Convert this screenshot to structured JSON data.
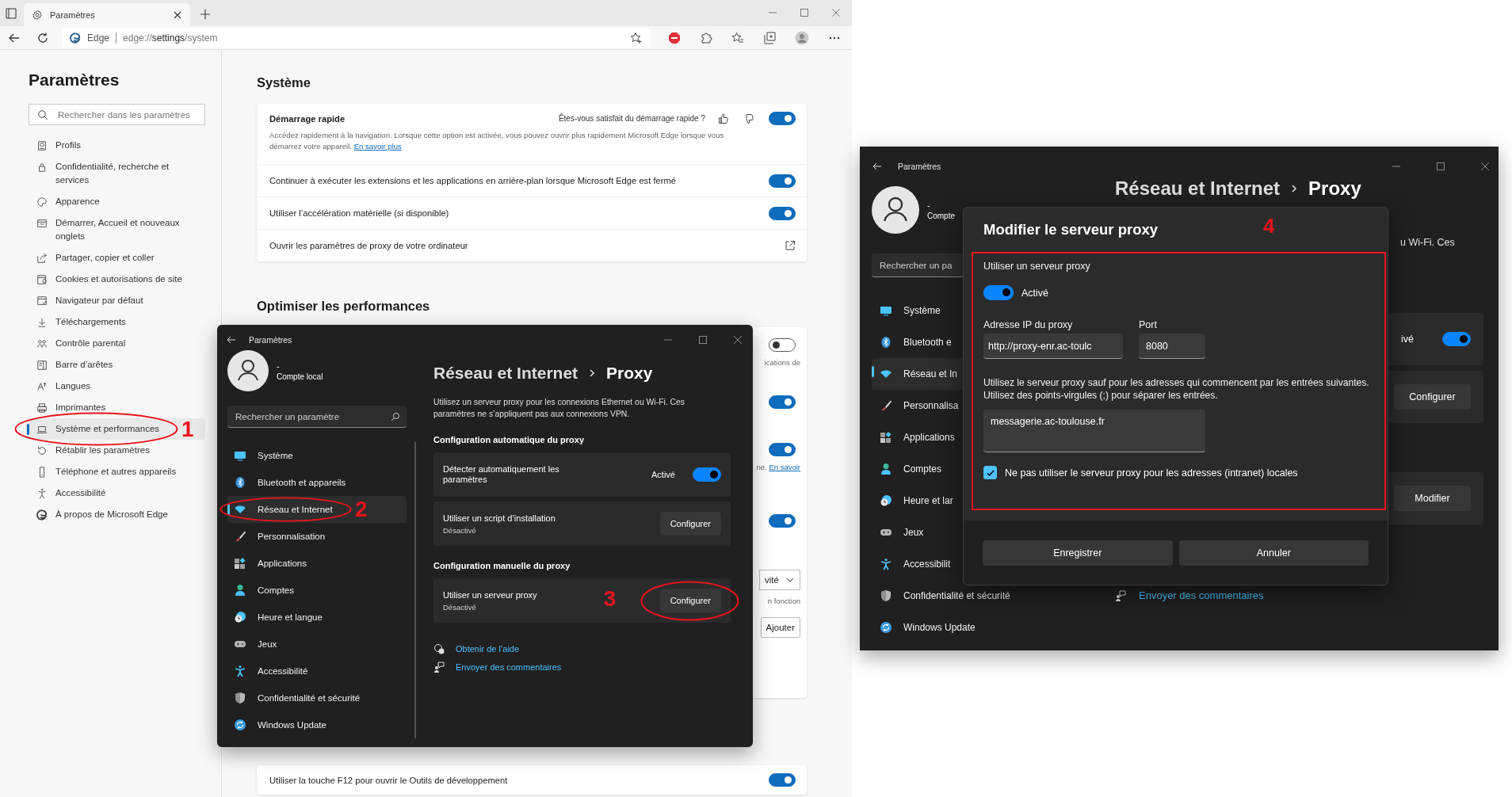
{
  "browser": {
    "tab_title": "Paramètres",
    "site": "Edge",
    "url_parts": [
      {
        "text": "edge://",
        "emphasis": false
      },
      {
        "text": "settings",
        "emphasis": true
      },
      {
        "text": "/system",
        "emphasis": false
      }
    ]
  },
  "sidebar": {
    "title": "Paramètres",
    "search_placeholder": "Rechercher dans les paramètres",
    "items": [
      {
        "label": "Profils",
        "selected": false
      },
      {
        "label": "Confidentialité, recherche et services",
        "selected": false
      },
      {
        "label": "Apparence",
        "selected": false
      },
      {
        "label": "Démarrer, Accueil et nouveaux onglets",
        "selected": false
      },
      {
        "label": "Partager, copier et coller",
        "selected": false
      },
      {
        "label": "Cookies et autorisations de site",
        "selected": false
      },
      {
        "label": "Navigateur par défaut",
        "selected": false
      },
      {
        "label": "Téléchargements",
        "selected": false
      },
      {
        "label": "Contrôle parental",
        "selected": false
      },
      {
        "label": "Barre d’arêtes",
        "selected": false
      },
      {
        "label": "Langues",
        "selected": false
      },
      {
        "label": "Imprimantes",
        "selected": false
      },
      {
        "label": "Système et performances",
        "selected": true,
        "annotation": "1"
      },
      {
        "label": "Rétablir les paramètres",
        "selected": false
      },
      {
        "label": "Téléphone et autres appareils",
        "selected": false
      },
      {
        "label": "Accessibilité",
        "selected": false
      },
      {
        "label": "À propos de Microsoft Edge",
        "selected": false
      }
    ]
  },
  "system": {
    "title": "Système",
    "rows": [
      {
        "kind": "feedback_toggle",
        "label": "Démarrage rapide",
        "question": "Êtes-vous satisfait du démarrage rapide ?",
        "description": "Accédez rapidement à la navigation. Lorsque cette option est activée, vous pouvez ouvrir plus rapidement Microsoft Edge lorsque vous démarrez votre appareil.",
        "link": "En savoir plus",
        "on": true
      },
      {
        "kind": "toggle",
        "label": "Continuer à exécuter les extensions et les applications en arrière-plan lorsque Microsoft Edge est fermé",
        "on": true
      },
      {
        "kind": "toggle",
        "label": "Utiliser l’accélération matérielle (si disponible)",
        "on": true
      },
      {
        "kind": "external",
        "label": "Ouvrir les paramètres de proxy de votre ordinateur"
      }
    ]
  },
  "performance": {
    "title": "Optimiser les performances",
    "rows": [
      {
        "kind": "toggle",
        "on": false,
        "note": "ications de"
      },
      {
        "kind": "toggle",
        "on": true
      },
      {
        "kind": "toggle",
        "on": true,
        "note": "ne.",
        "link": "En savoir"
      },
      {
        "kind": "toggle",
        "on": true
      },
      {
        "kind": "dropdown",
        "value": "vité",
        "note": "n fonction"
      },
      {
        "kind": "button",
        "label": "Ajouter"
      }
    ]
  },
  "devtools": {
    "rows": [
      {
        "kind": "toggle",
        "label": "Utiliser la touche F12 pour ouvrir le Outils de développement",
        "on": true
      }
    ]
  },
  "settings_window": {
    "title": "Paramètres",
    "account": {
      "name": "-",
      "type": "Compte local"
    },
    "search_placeholder": "Rechercher un paramètre",
    "nav": [
      {
        "label": "Système",
        "selected": false
      },
      {
        "label": "Bluetooth et appareils",
        "selected": false
      },
      {
        "label": "Réseau et Internet",
        "selected": true,
        "annotation": "2"
      },
      {
        "label": "Personnalisation",
        "selected": false
      },
      {
        "label": "Applications",
        "selected": false
      },
      {
        "label": "Comptes",
        "selected": false
      },
      {
        "label": "Heure et langue",
        "selected": false
      },
      {
        "label": "Jeux",
        "selected": false
      },
      {
        "label": "Accessibilité",
        "selected": false
      },
      {
        "label": "Confidentialité et sécurité",
        "selected": false
      },
      {
        "label": "Windows Update",
        "selected": false
      }
    ],
    "breadcrumb": [
      "Réseau et Internet",
      "Proxy"
    ],
    "description": "Utilisez un serveur proxy pour les connexions Ethernet ou Wi-Fi. Ces paramètres ne s’appliquent pas aux connexions VPN.",
    "sections": [
      {
        "title": "Configuration automatique du proxy",
        "cards": [
          {
            "kind": "toggle",
            "label": "Détecter automatiquement les paramètres",
            "state": "Activé",
            "on": true
          },
          {
            "kind": "button",
            "label": "Utiliser un script d’installation",
            "status": "Désactivé",
            "button": "Configurer"
          }
        ]
      },
      {
        "title": "Configuration manuelle du proxy",
        "cards": [
          {
            "kind": "button",
            "label": "Utiliser un serveur proxy",
            "status": "Désactivé",
            "button": "Configurer",
            "annotation": "3"
          }
        ]
      }
    ],
    "links": [
      "Obtenir de l’aide",
      "Envoyer des commentaires"
    ]
  },
  "proxy_window": {
    "title": "Paramètres",
    "account": {
      "name": "-",
      "type": "Compte"
    },
    "search_placeholder": "Rechercher un pa",
    "nav": [
      {
        "label": "Système",
        "selected": false
      },
      {
        "label": "Bluetooth e",
        "selected": false
      },
      {
        "label": "Réseau et In",
        "selected": true
      },
      {
        "label": "Personnalisa",
        "selected": false
      },
      {
        "label": "Applications",
        "selected": false
      },
      {
        "label": "Comptes",
        "selected": false
      },
      {
        "label": "Heure et lar",
        "selected": false
      },
      {
        "label": "Jeux",
        "selected": false
      },
      {
        "label": "Accessibilit",
        "selected": false
      },
      {
        "label": "Confidentialité et sécurité",
        "selected": false
      },
      {
        "label": "Windows Update",
        "selected": false
      }
    ],
    "breadcrumb": [
      "Réseau et Internet",
      "Proxy"
    ],
    "description": "u Wi-Fi. Ces",
    "cards": [
      {
        "kind": "toggle",
        "state": "ivé",
        "on": true
      },
      {
        "kind": "button",
        "button": "Configurer"
      },
      {
        "kind": "button",
        "button": "Modifier"
      }
    ],
    "link": "Envoyer des commentaires",
    "dialog": {
      "title": "Modifier le serveur proxy",
      "annotation": "4",
      "use_proxy_label": "Utiliser un serveur proxy",
      "use_proxy": {
        "on": true,
        "state": "Activé"
      },
      "address_label": "Adresse IP du proxy",
      "address": "http://proxy-enr.ac-toulc",
      "port_label": "Port",
      "port": "8080",
      "exceptions_help": "Utilisez le serveur proxy sauf pour les adresses qui commencent par les entrées suivantes. Utilisez des points-virgules (;) pour séparer les entrées.",
      "exceptions": "messagerie.ac-toulouse.fr",
      "bypass_local": {
        "checked": true,
        "label": "Ne pas utiliser le serveur proxy pour les adresses (intranet) locales"
      },
      "buttons": [
        "Enregistrer",
        "Annuler"
      ]
    }
  }
}
